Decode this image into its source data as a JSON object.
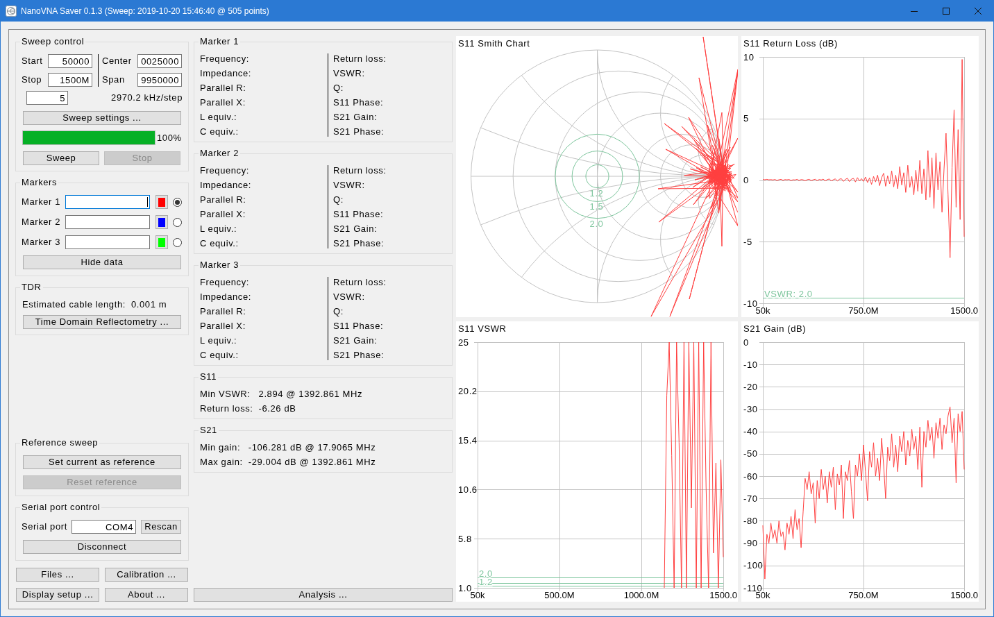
{
  "window": {
    "title": "NanoVNA Saver 0.1.3 (Sweep: 2019-10-20 15:46:40 @ 505 points)"
  },
  "sweep_control": {
    "title": "Sweep control",
    "fields": [
      {
        "label": "Start",
        "value": "50000"
      },
      {
        "label": "Center",
        "value": "0025000"
      },
      {
        "label": "Stop",
        "value": "1500M"
      },
      {
        "label": "Span",
        "value": "9950000"
      }
    ],
    "row_3_field": {
      "value": "5"
    },
    "step_size": "2970.2 kHz/step",
    "settings_button": "Sweep settings ...",
    "progress": {
      "level": 1,
      "text": "100%"
    },
    "buttons": [
      {
        "label": "Sweep",
        "disabled": false
      },
      {
        "label": "Stop",
        "disabled": true
      }
    ]
  },
  "markers": {
    "title": "Markers",
    "items": [
      {
        "label": "Marker 1",
        "focused": true,
        "color": "#ff0000",
        "selected": true
      },
      {
        "label": "Marker 2",
        "focused": false,
        "color": "#0000ff",
        "selected": false
      },
      {
        "label": "Marker 3",
        "focused": false,
        "color": "#00ff00",
        "selected": false
      }
    ],
    "hide_button": "Hide data"
  },
  "tdr": {
    "title": "TDR",
    "result": {
      "label": "Estimated cable length:",
      "value": "0.001 m"
    },
    "button": "Time Domain Reflectometry ..."
  },
  "reference_sweep": {
    "title": "Reference sweep",
    "buttons": [
      {
        "label": "Set current as reference",
        "disabled": false
      },
      {
        "label": "Reset reference",
        "disabled": true
      }
    ]
  },
  "serial_port": {
    "title": "Serial port control",
    "label": "Serial port",
    "port": "COM4",
    "rescan_button": "Rescan",
    "connect_button": "Disconnect"
  },
  "bottom_buttons": [
    "Files ...",
    "Calibration ...",
    "Display setup ...",
    "About ..."
  ],
  "marker_details": [
    {
      "title": "Marker 1",
      "left_labels": [
        "Frequency:",
        "Impedance:",
        "Parallel R:",
        "Parallel X:",
        "L equiv.:",
        "C equiv.:"
      ],
      "right_labels": [
        "Return loss:",
        "VSWR:",
        "Q:",
        "S11 Phase:",
        "S21 Gain:",
        "S21 Phase:"
      ]
    },
    {
      "title": "Marker 2",
      "left_labels": [
        "Frequency:",
        "Impedance:",
        "Parallel R:",
        "Parallel X:",
        "L equiv.:",
        "C equiv.:"
      ],
      "right_labels": [
        "Return loss:",
        "VSWR:",
        "Q:",
        "S11 Phase:",
        "S21 Gain:",
        "S21 Phase:"
      ]
    },
    {
      "title": "Marker 3",
      "left_labels": [
        "Frequency:",
        "Impedance:",
        "Parallel R:",
        "Parallel X:",
        "L equiv.:",
        "C equiv.:"
      ],
      "right_labels": [
        "Return loss:",
        "VSWR:",
        "Q:",
        "S11 Phase:",
        "S21 Gain:",
        "S21 Phase:"
      ]
    }
  ],
  "s11_summary": {
    "title": "S11",
    "rows": [
      {
        "label": "Min VSWR:",
        "value": "2.894 @ 1392.861 MHz"
      },
      {
        "label": "Return loss:",
        "value": "-6.26 dB"
      }
    ]
  },
  "s21_summary": {
    "title": "S21",
    "rows": [
      {
        "label": "Min gain:",
        "value": "-106.281 dB @ 17.9065 MHz"
      },
      {
        "label": "Max gain:",
        "value": "-29.004 dB @ 1392.861 MHz"
      }
    ]
  },
  "analysis_button": "Analysis ...",
  "charts": {
    "smith": {
      "title": "S11 Smith Chart",
      "vswr_circles": [
        {
          "label": "1.2"
        },
        {
          "label": "1.5"
        },
        {
          "label": "2.0"
        }
      ]
    },
    "return_loss": {
      "chart_data": {
        "type": "line",
        "title": "S11 Return Loss (dB)",
        "x": [
          50000,
          15000000,
          30000000,
          45000000,
          60000000,
          75000000,
          90000000,
          105000000,
          120000000,
          135000000,
          150000000,
          165000000,
          180000000,
          195000000,
          210000000,
          225000000,
          240000000,
          255000000,
          270000000,
          285000000,
          300000000,
          315000000,
          330000000,
          345000000,
          360000000,
          375000000,
          390000000,
          405000000,
          420000000,
          435000000,
          450000000,
          465000000,
          480000000,
          495000000,
          510000000,
          525000000,
          540000000,
          555000000,
          570000000,
          585000000,
          600000000,
          615000000,
          630000000,
          645000000,
          660000000,
          675000000,
          690000000,
          705000000,
          720000000,
          735000000,
          750000000,
          765000000,
          780000000,
          795000000,
          810000000,
          825000000,
          840000000,
          855000000,
          870000000,
          885000000,
          900000000,
          915000000,
          930000000,
          945000000,
          960000000,
          975000000,
          990000000,
          1005000000,
          1020000000,
          1035000000,
          1050000000,
          1065000000,
          1080000000,
          1095000000,
          1110000000,
          1125000000,
          1140000000,
          1155000000,
          1170000000,
          1185000000,
          1200000000,
          1215000000,
          1230000000,
          1245000000,
          1260000000,
          1275000000,
          1290000000,
          1305000000,
          1320000000,
          1335000000,
          1350000000,
          1365000000,
          1380000000,
          1395000000,
          1410000000,
          1425000000,
          1440000000,
          1455000000,
          1470000000,
          1485000000,
          1500000000
        ],
        "series": [
          {
            "color": "#ff4040",
            "values": [
              0.05,
              0.03,
              0.06,
              0.02,
              0.04,
              0.01,
              0.05,
              -0.02,
              0.03,
              0.06,
              -0.01,
              0.04,
              0.02,
              0.05,
              -0.03,
              0.03,
              0.01,
              0.06,
              -0.02,
              0.04,
              0.02,
              -0.05,
              0.03,
              0.06,
              -0.03,
              0.02,
              0.07,
              -0.04,
              0.05,
              0.01,
              0.08,
              -0.06,
              0.04,
              0.09,
              -0.05,
              0.03,
              0.1,
              -0.08,
              0.06,
              0.12,
              -0.1,
              0.05,
              0.15,
              -0.12,
              0.08,
              0.14,
              -0.15,
              0.2,
              -0.08,
              0.12,
              -0.1,
              0.25,
              -0.2,
              0.18,
              -0.35,
              0.3,
              -0.15,
              0.4,
              -0.45,
              0.2,
              0.55,
              -0.5,
              0.35,
              -0.3,
              0.75,
              -0.55,
              0.4,
              -0.7,
              1.1,
              -0.4,
              0.6,
              -1.0,
              1.2,
              -0.6,
              0.3,
              -1.2,
              0.8,
              -0.9,
              1.6,
              -1.1,
              0.9,
              -1.6,
              2.4,
              -1.4,
              1.8,
              -2.3,
              2.2,
              -0.8,
              1.5,
              -2.6,
              0.9,
              3.8,
              -1.2,
              -6.3,
              1.0,
              5.7,
              -2.2,
              4.1,
              -3.2,
              9.8,
              -4.6
            ]
          }
        ],
        "xlim": [
          50000,
          1500000000
        ],
        "ylim": [
          -10,
          10
        ],
        "xticks": [
          {
            "value": 50000,
            "label": "50k"
          },
          {
            "value": 750000000,
            "label": "750.0M"
          }
        ],
        "yticks": [
          10,
          5,
          0,
          -5,
          -10
        ],
        "grid": true,
        "ref_lines": [
          {
            "axis": "y",
            "value": -9.54
          }
        ],
        "annotations": [
          {
            "text": "VSWR: 2.0",
            "y": -9.54
          }
        ]
      },
      "x_axis_end_label": "1500.0"
    },
    "vswr": {
      "chart_data": {
        "type": "line",
        "title": "S11 VSWR",
        "x": [
          1140000000,
          1155000000,
          1170000000,
          1185000000,
          1200000000,
          1215000000,
          1230000000,
          1245000000,
          1260000000,
          1275000000,
          1290000000,
          1305000000,
          1320000000,
          1335000000,
          1350000000,
          1365000000,
          1380000000,
          1395000000,
          1410000000,
          1425000000,
          1440000000,
          1455000000,
          1470000000,
          1485000000,
          1500000000
        ],
        "series": [
          {
            "color": "#ff4040",
            "values": [
              1,
              19.8,
              25,
              13.9,
              1,
              25,
              15.2,
              1,
              25,
              1,
              25,
              8.8,
              25,
              1,
              25,
              1,
              25,
              10.9,
              1,
              25,
              4.4,
              13.2,
              1,
              13.5,
              4
            ]
          }
        ],
        "xlim": [
          50000,
          1500000000
        ],
        "ylim": [
          1,
          25
        ],
        "xticks": [
          {
            "value": 50000,
            "label": "50k"
          },
          {
            "value": 500000000,
            "label": "500.0M"
          },
          {
            "value": 1000000000,
            "label": "1000.0M"
          }
        ],
        "yticks": [
          25,
          20.2,
          15.4,
          10.6,
          5.8,
          {
            "value": 1,
            "label": "1.0"
          }
        ],
        "grid": true,
        "ref_lines": [
          {
            "axis": "y",
            "value": 2,
            "label": "2.0"
          },
          {
            "axis": "y",
            "value": 1.5
          },
          {
            "axis": "y",
            "value": 1.2,
            "label": "1.2"
          }
        ]
      },
      "x_axis_end_label": "1500.0"
    },
    "gain": {
      "chart_data": {
        "type": "line",
        "title": "S21 Gain (dB)",
        "x": [
          50000,
          15000000,
          30000000,
          45000000,
          60000000,
          75000000,
          90000000,
          105000000,
          120000000,
          135000000,
          150000000,
          165000000,
          180000000,
          195000000,
          210000000,
          225000000,
          240000000,
          255000000,
          270000000,
          285000000,
          300000000,
          315000000,
          330000000,
          345000000,
          360000000,
          375000000,
          390000000,
          405000000,
          420000000,
          435000000,
          450000000,
          465000000,
          480000000,
          495000000,
          510000000,
          525000000,
          540000000,
          555000000,
          570000000,
          585000000,
          600000000,
          615000000,
          630000000,
          645000000,
          660000000,
          675000000,
          690000000,
          705000000,
          720000000,
          735000000,
          750000000,
          765000000,
          780000000,
          795000000,
          810000000,
          825000000,
          840000000,
          855000000,
          870000000,
          885000000,
          900000000,
          915000000,
          930000000,
          945000000,
          960000000,
          975000000,
          990000000,
          1005000000,
          1020000000,
          1035000000,
          1050000000,
          1065000000,
          1080000000,
          1095000000,
          1110000000,
          1125000000,
          1140000000,
          1155000000,
          1170000000,
          1185000000,
          1200000000,
          1215000000,
          1230000000,
          1245000000,
          1260000000,
          1275000000,
          1290000000,
          1305000000,
          1320000000,
          1335000000,
          1350000000,
          1365000000,
          1380000000,
          1395000000,
          1410000000,
          1425000000,
          1440000000,
          1455000000,
          1470000000,
          1485000000,
          1500000000
        ],
        "series": [
          {
            "color": "#ff4040",
            "values": [
              -82,
              -106,
              -86,
              -90,
              -81,
              -88,
              -84,
              -90,
              -80,
              -87,
              -85,
              -93,
              -81,
              -86,
              -78,
              -88,
              -75,
              -84,
              -79,
              -92,
              -76,
              -61,
              -66,
              -58,
              -68,
              -63,
              -81,
              -62,
              -70,
              -57,
              -66,
              -60,
              -72,
              -58,
              -65,
              -56,
              -75,
              -59,
              -64,
              -55,
              -79,
              -58,
              -62,
              -53,
              -67,
              -79,
              -55,
              -60,
              -50,
              -62,
              -46,
              -58,
              -71,
              -49,
              -56,
              -45,
              -60,
              -52,
              -62,
              -43,
              -55,
              -70,
              -47,
              -53,
              -41,
              -56,
              -46,
              -58,
              -42,
              -49,
              -40,
              -55,
              -44,
              -51,
              -39,
              -48,
              -42,
              -57,
              -38,
              -65,
              -40,
              -47,
              -35,
              -44,
              -38,
              -52,
              -36,
              -43,
              -34,
              -48,
              -37,
              -41,
              -33,
              -29,
              -45,
              -34,
              -63,
              -32,
              -40,
              -31,
              -57
            ]
          }
        ],
        "xlim": [
          50000,
          1500000000
        ],
        "ylim": [
          -110,
          0
        ],
        "xticks": [
          {
            "value": 50000,
            "label": "50k"
          },
          {
            "value": 750000000,
            "label": "750.0M"
          }
        ],
        "yticks": [
          0,
          -10,
          -20,
          -30,
          -40,
          -50,
          -60,
          -70,
          -80,
          -90,
          -100,
          -110
        ],
        "grid": true
      },
      "x_axis_end_label": "1500.0"
    }
  }
}
